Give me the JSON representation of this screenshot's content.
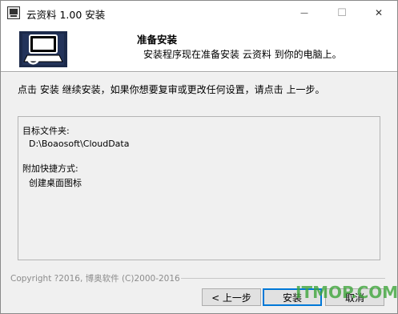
{
  "window": {
    "title": "云资料 1.00 安装"
  },
  "titlebar_buttons": {
    "minimize": "—",
    "maximize": "☐",
    "close": "✕"
  },
  "header": {
    "title": "准备安装",
    "subtitle": "安装程序现在准备安装 云资料 到你的电脑上。"
  },
  "instruction": "点击 安装 继续安装，如果你想要复审或更改任何设置，请点击 上一步。",
  "memo": {
    "dest_label": "目标文件夹:",
    "dest_value": "D:\\Boaosoft\\CloudData",
    "shortcut_label": "附加快捷方式:",
    "shortcut_value": "创建桌面图标"
  },
  "footer": {
    "copyright": "Copyright ?2016, 博奥软件 (C)2000-2016",
    "back": "< 上一步",
    "install": "安装",
    "cancel": "取消"
  },
  "watermark": "ITMOP.COM",
  "colors": {
    "accent": "#0078d7",
    "watermark": "#3fa63b"
  }
}
